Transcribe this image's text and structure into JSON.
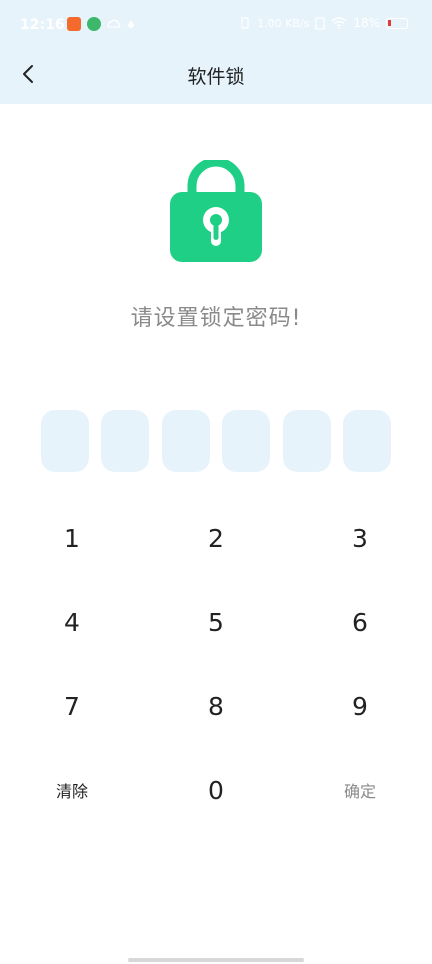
{
  "status_bar": {
    "time": "12:16",
    "signal_text": "1.00 KB/s",
    "battery": "18%"
  },
  "header": {
    "title": "软件锁",
    "back_icon": "chevron-left-icon"
  },
  "lock": {
    "icon": "padlock-icon",
    "color": "#1fcf85",
    "prompt": "请设置锁定密码!"
  },
  "pin": {
    "length": 6
  },
  "keypad": {
    "k1": "1",
    "k2": "2",
    "k3": "3",
    "k4": "4",
    "k5": "5",
    "k6": "6",
    "k7": "7",
    "k8": "8",
    "k9": "9",
    "clear": "清除",
    "k0": "0",
    "confirm": "确定"
  }
}
